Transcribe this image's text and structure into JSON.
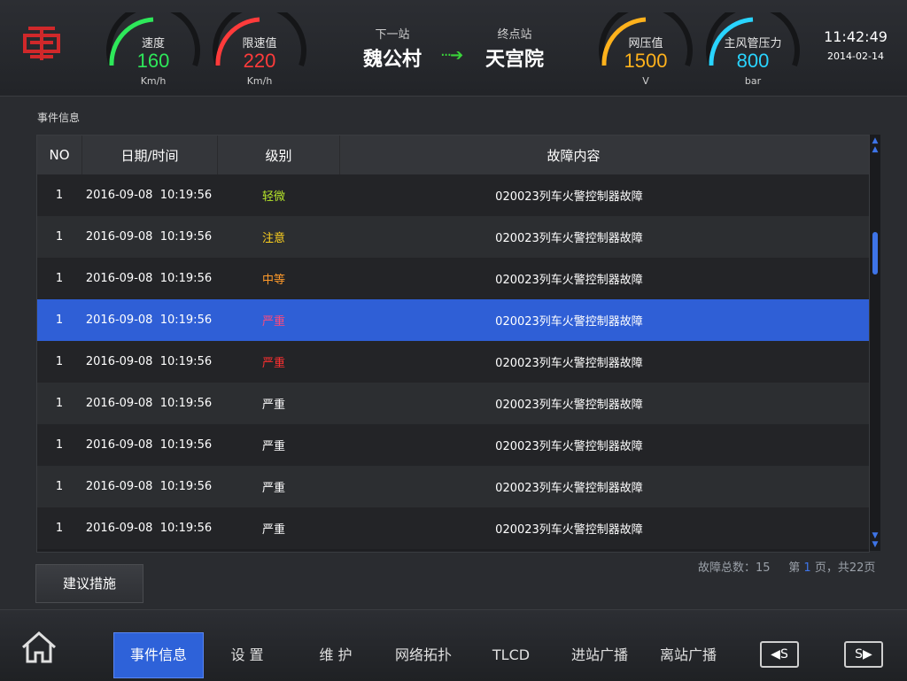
{
  "header": {
    "gauges": [
      {
        "label": "速度",
        "value": "160",
        "unit": "Km/h",
        "color": "#2ee85a"
      },
      {
        "label": "限速值",
        "value": "220",
        "unit": "Km/h",
        "color": "#ff3b3b"
      },
      {
        "label": "网压值",
        "value": "1500",
        "unit": "V",
        "color": "#ffb21c"
      },
      {
        "label": "主风管压力",
        "value": "800",
        "unit": "bar",
        "color": "#29d4ff"
      }
    ],
    "next_station_label": "下一站",
    "next_station": "魏公村",
    "terminal_label": "终点站",
    "terminal": "天宫院",
    "time": "11:42:49",
    "date": "2014-02-14"
  },
  "section_title": "事件信息",
  "table": {
    "headers": [
      "NO",
      "日期/时间",
      "级别",
      "故障内容"
    ],
    "rows": [
      {
        "no": "1",
        "date": "2016-09-08",
        "time": "10:19:56",
        "level": "轻微",
        "level_color": "#b6e62a",
        "content": "020023列车火警控制器故障"
      },
      {
        "no": "1",
        "date": "2016-09-08",
        "time": "10:19:56",
        "level": "注意",
        "level_color": "#ffd21e",
        "content": "020023列车火警控制器故障"
      },
      {
        "no": "1",
        "date": "2016-09-08",
        "time": "10:19:56",
        "level": "中等",
        "level_color": "#ff9a2a",
        "content": "020023列车火警控制器故障"
      },
      {
        "no": "1",
        "date": "2016-09-08",
        "time": "10:19:56",
        "level": "严重",
        "level_color": "#ff4a7a",
        "content": "020023列车火警控制器故障",
        "selected": true
      },
      {
        "no": "1",
        "date": "2016-09-08",
        "time": "10:19:56",
        "level": "严重",
        "level_color": "#ff3030",
        "content": "020023列车火警控制器故障"
      },
      {
        "no": "1",
        "date": "2016-09-08",
        "time": "10:19:56",
        "level": "严重",
        "level_color": "#ffffff",
        "content": "020023列车火警控制器故障"
      },
      {
        "no": "1",
        "date": "2016-09-08",
        "time": "10:19:56",
        "level": "严重",
        "level_color": "#ffffff",
        "content": "020023列车火警控制器故障"
      },
      {
        "no": "1",
        "date": "2016-09-08",
        "time": "10:19:56",
        "level": "严重",
        "level_color": "#ffffff",
        "content": "020023列车火警控制器故障"
      },
      {
        "no": "1",
        "date": "2016-09-08",
        "time": "10:19:56",
        "level": "严重",
        "level_color": "#ffffff",
        "content": "020023列车火警控制器故障"
      }
    ]
  },
  "pager": {
    "total_label": "故障总数：",
    "total": "15",
    "page_prefix": "第",
    "page": "1",
    "page_mid": "页，共",
    "pages": "22",
    "page_suffix": "页"
  },
  "advice_button": "建议措施",
  "nav": {
    "items": [
      "事件信息",
      "设 置",
      "维 护",
      "网络拓扑",
      "TLCD",
      "进站广播",
      "离站广播"
    ],
    "prev_label": "S",
    "next_label": "S"
  },
  "icons": {
    "home": "home-icon",
    "logo": "railway-logo-icon",
    "prev": "triangle-left-icon",
    "next": "triangle-right-icon"
  }
}
